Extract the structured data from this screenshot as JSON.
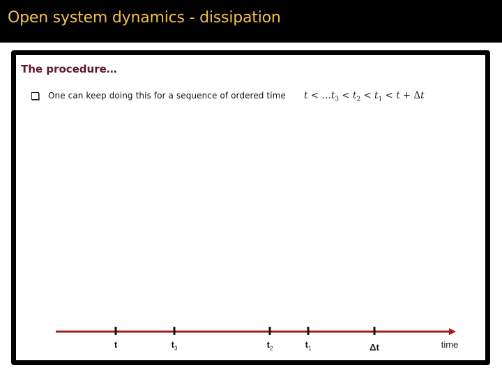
{
  "slide": {
    "title": "Open system dynamics - dissipation",
    "section_heading": "The procedure…",
    "bullet": {
      "icon": "checkbox-icon",
      "text": "One can keep doing this for a sequence of ordered time"
    },
    "formula": {
      "t": "t",
      "lt": " < ",
      "ellipsis": "…",
      "t3": "t",
      "t3_sub": "3",
      "t2": "t",
      "t2_sub": "2",
      "t1": "t",
      "t1_sub": "1",
      "plus": " + ",
      "delta": "Δ",
      "t_end": "t"
    }
  },
  "timeline": {
    "axis_label": "time",
    "axis_color": "#a31c1c",
    "ticks": [
      {
        "id": "t",
        "base": "t",
        "sub": "",
        "position": 0.22
      },
      {
        "id": "t3",
        "base": "t",
        "sub": "3",
        "position": 0.35
      },
      {
        "id": "t2",
        "base": "t",
        "sub": "2",
        "position": 0.56
      },
      {
        "id": "t1",
        "base": "t",
        "sub": "1",
        "position": 0.645
      },
      {
        "id": "delta-t",
        "base": "Δt",
        "sub": "",
        "position": 0.79
      }
    ]
  }
}
